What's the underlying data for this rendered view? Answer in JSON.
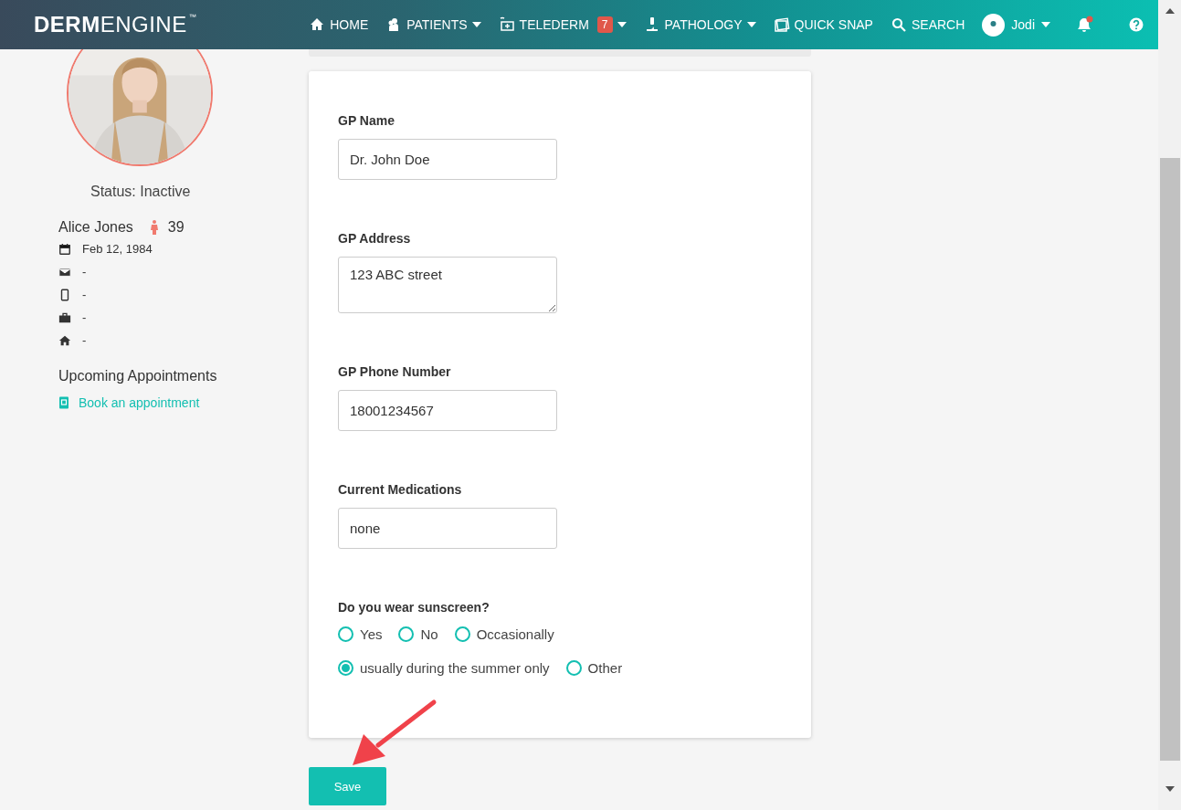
{
  "navbar": {
    "logo": {
      "bold": "DERM",
      "light": "ENGINE",
      "mark": "™"
    },
    "items": [
      {
        "label": "HOME",
        "dropdown": false
      },
      {
        "label": "PATIENTS",
        "dropdown": true
      },
      {
        "label": "TELEDERM",
        "badge": "7",
        "dropdown": true
      },
      {
        "label": "PATHOLOGY",
        "dropdown": true
      },
      {
        "label": "QUICK SNAP",
        "dropdown": false
      },
      {
        "label": "SEARCH",
        "dropdown": false
      }
    ],
    "user": {
      "name": "Jodi",
      "dropdown": true
    },
    "notifications": {
      "unread": true
    }
  },
  "profile": {
    "status": "Status: Inactive",
    "name": "Alice Jones",
    "age": "39",
    "details": [
      {
        "kind": "birthdate",
        "text": "Feb 12, 1984"
      },
      {
        "kind": "email",
        "text": "-"
      },
      {
        "kind": "phone",
        "text": "-"
      },
      {
        "kind": "work",
        "text": "-"
      },
      {
        "kind": "home",
        "text": "-"
      }
    ],
    "appointments": {
      "title": "Upcoming Appointments",
      "link": "Book an appointment"
    }
  },
  "form": {
    "fields": [
      {
        "kind": "text",
        "label": "GP Name",
        "value": "Dr. John Doe"
      },
      {
        "kind": "textarea",
        "label": "GP Address",
        "value": "123 ABC street"
      },
      {
        "kind": "text",
        "label": "GP Phone Number",
        "value": "18001234567"
      },
      {
        "kind": "text",
        "label": "Current Medications",
        "value": "none"
      }
    ],
    "question": {
      "label": "Do you wear sunscreen?",
      "option_rows": [
        [
          {
            "label": "Yes",
            "selected": false
          },
          {
            "label": "No",
            "selected": false
          },
          {
            "label": "Occasionally",
            "selected": false
          }
        ],
        [
          {
            "label": "usually during the summer only",
            "selected": true
          },
          {
            "label": "Other",
            "selected": false
          }
        ]
      ]
    }
  },
  "save_button": "Save"
}
